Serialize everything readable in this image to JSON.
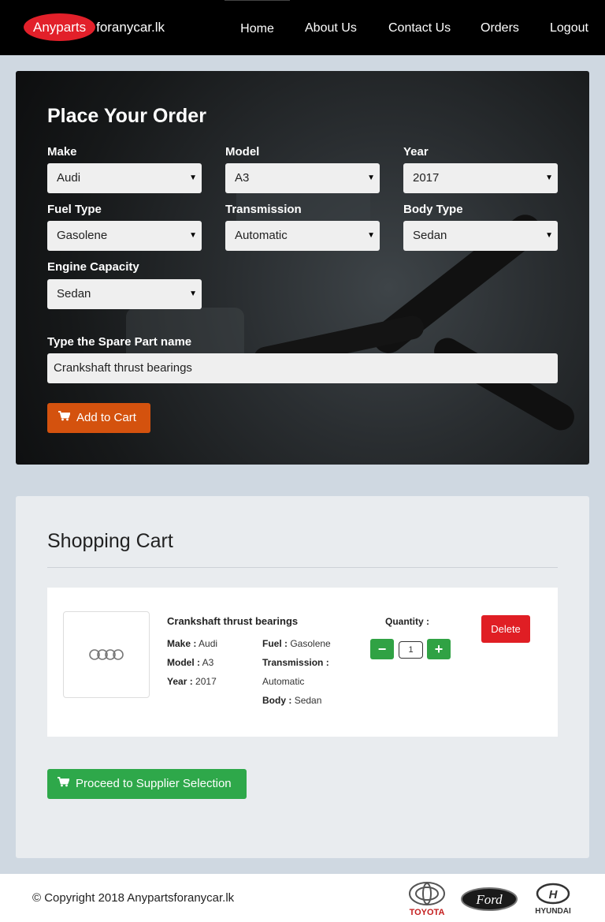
{
  "navbar": {
    "logo_main": "Anyparts",
    "logo_rest": "foranycar.lk",
    "items": [
      {
        "label": "Home"
      },
      {
        "label": "About Us"
      },
      {
        "label": "Contact Us"
      },
      {
        "label": "Orders"
      },
      {
        "label": "Logout"
      }
    ],
    "active": "Home"
  },
  "order_form": {
    "title": "Place Your Order",
    "fields": {
      "make": {
        "label": "Make",
        "value": "Audi"
      },
      "model": {
        "label": "Model",
        "value": "A3"
      },
      "year": {
        "label": "Year",
        "value": "2017"
      },
      "fuel_type": {
        "label": "Fuel Type",
        "value": "Gasolene"
      },
      "transmission": {
        "label": "Transmission",
        "value": "Automatic"
      },
      "body_type": {
        "label": "Body Type",
        "value": "Sedan"
      },
      "engine_capacity": {
        "label": "Engine Capacity",
        "value": "Sedan"
      }
    },
    "spare_part": {
      "label": "Type the Spare Part name",
      "value": "Crankshaft thrust bearings"
    },
    "add_to_cart_label": "Add to Cart"
  },
  "cart": {
    "title": "Shopping Cart",
    "item": {
      "name": "Crankshaft thrust bearings",
      "make_label": "Make :",
      "make": "Audi",
      "model_label": "Model :",
      "model": "A3",
      "year_label": "Year :",
      "year": "2017",
      "fuel_label": "Fuel :",
      "fuel": "Gasolene",
      "transmission_label": "Transmission :",
      "transmission": "Automatic",
      "body_label": "Body :",
      "body": "Sedan",
      "quantity_label": "Quantity :",
      "quantity": "1",
      "delete_label": "Delete",
      "thumbnail_icon": "audi-rings-logo"
    },
    "proceed_label": "Proceed to Supplier Selection"
  },
  "footer": {
    "copyright": "© Copyright 2018 Anypartsforanycar.lk",
    "brands": [
      "TOYOTA",
      "Ford",
      "HYUNDAI"
    ]
  },
  "colors": {
    "navbar_bg": "#000000",
    "logo_red": "#e2202a",
    "add_to_cart": "#d4520e",
    "delete": "#e01e24",
    "proceed": "#2ea84a",
    "page_bg": "#cfd8e1"
  }
}
